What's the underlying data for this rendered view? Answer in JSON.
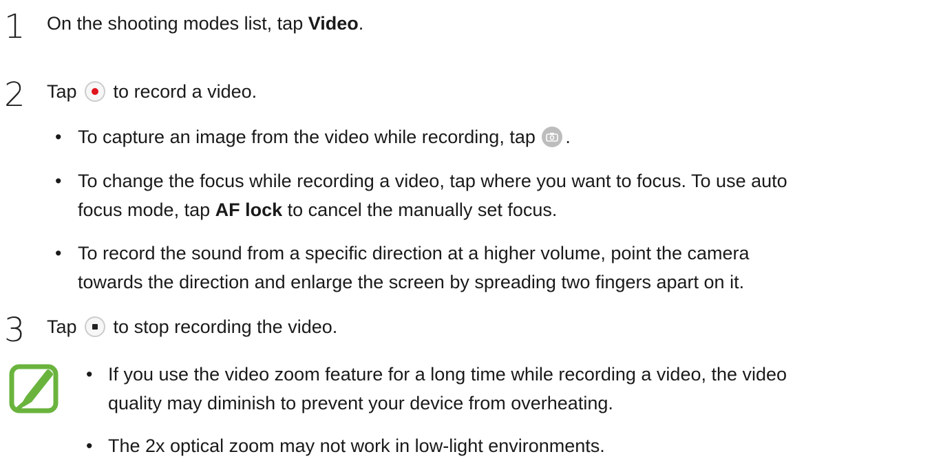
{
  "steps": [
    {
      "number": "1",
      "text_before": "On the shooting modes list, tap ",
      "bold": "Video",
      "text_after": "."
    },
    {
      "number": "2",
      "text_before": "Tap ",
      "icon": "record-icon",
      "text_after": " to record a video."
    },
    {
      "number": "3",
      "text_before": "Tap ",
      "icon": "stop-icon",
      "text_after": " to stop recording the video."
    }
  ],
  "bullets": {
    "b1": {
      "text_before": "To capture an image from the video while recording, tap ",
      "icon": "camera-icon",
      "text_after": "."
    },
    "b2": {
      "line1": "To change the focus while recording a video, tap where you want to focus. To use auto",
      "line2_before": "focus mode, tap ",
      "line2_bold": "AF lock",
      "line2_after": " to cancel the manually set focus."
    },
    "b3": {
      "line1": "To record the sound from a specific direction at a higher volume, point the camera",
      "line2": "towards the direction and enlarge the screen by spreading two fingers apart on it."
    }
  },
  "note": {
    "icon": "note-pencil-icon",
    "accent_color": "#6ab43e",
    "items": [
      {
        "line1": "If you use the video zoom feature for a long time while recording a video, the video",
        "line2": "quality may diminish to prevent your device from overheating."
      },
      {
        "line1": "The 2x optical zoom may not work in low-light environments."
      }
    ]
  },
  "bullet_char": "•"
}
